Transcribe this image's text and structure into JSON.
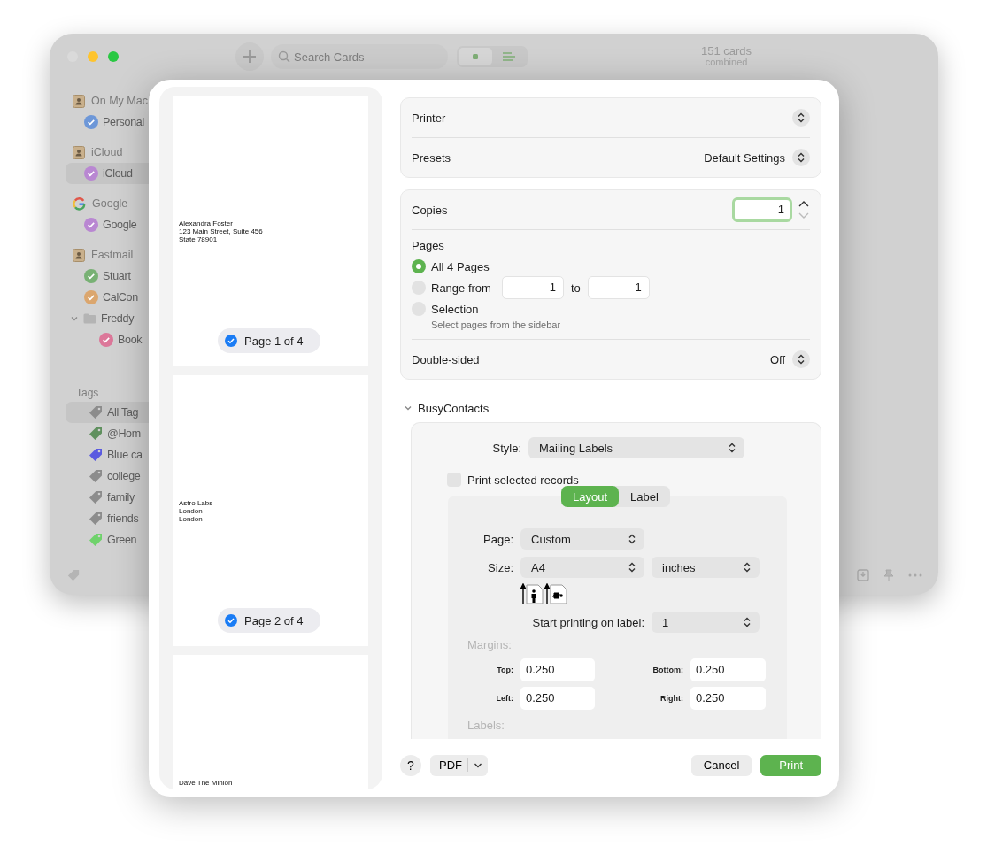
{
  "background_window": {
    "toolbar": {
      "search": {
        "placeholder": "Search Cards"
      },
      "card_count": "151 cards",
      "card_count_caption": "combined"
    },
    "sidebar": {
      "sources": [
        {
          "title": "On My Mac",
          "kind": "book",
          "items": [
            {
              "label": "Personal",
              "kind": "calendar",
              "color": "#6d97d8",
              "selected": false
            }
          ]
        },
        {
          "title": "iCloud",
          "kind": "book",
          "items": [
            {
              "label": "iCloud",
              "kind": "calendar",
              "color": "#b987d2",
              "selected": true
            }
          ]
        },
        {
          "title": "Google",
          "kind": "google",
          "items": [
            {
              "label": "Google",
              "kind": "calendar",
              "color": "#b987d2",
              "selected": false
            }
          ]
        },
        {
          "title": "Fastmail",
          "kind": "book",
          "items": [
            {
              "label": "Stuart",
              "kind": "calendar",
              "color": "#78b174",
              "selected": false
            },
            {
              "label": "CalCon",
              "kind": "calendar",
              "color": "#dba66e",
              "selected": false
            },
            {
              "label": "Freddy",
              "kind": "folder",
              "expanded": true,
              "selected": false,
              "children": [
                {
                  "label": "Book",
                  "kind": "calendar",
                  "color": "#dc7799",
                  "selected": false
                }
              ]
            }
          ]
        }
      ],
      "tags_heading": "Tags",
      "tags": [
        {
          "label": "All Tag",
          "color": "#8c8c8c",
          "selected": true
        },
        {
          "label": "@Hom",
          "color": "#5f905e",
          "selected": false
        },
        {
          "label": "Blue ca",
          "color": "#5a5ae0",
          "selected": false
        },
        {
          "label": "college",
          "color": "#8c8c8c",
          "selected": false
        },
        {
          "label": "family",
          "color": "#8c8c8c",
          "selected": false
        },
        {
          "label": "friends",
          "color": "#8c8c8c",
          "selected": false
        },
        {
          "label": "Green",
          "color": "#6fd26b",
          "selected": false
        }
      ]
    }
  },
  "print_dialog": {
    "preview_pages": [
      {
        "label": "Page 1 of 4",
        "checked": true,
        "address_lines": [
          "Alexandra Foster",
          "123 Main Street, Suite 456",
          "State 78901"
        ]
      },
      {
        "label": "Page 2 of 4",
        "checked": true,
        "address_lines": [
          "Astro Labs",
          "London",
          "London"
        ]
      },
      {
        "address_lines": [
          "Dave The Minion"
        ]
      }
    ],
    "printer": {
      "label": "Printer"
    },
    "presets": {
      "label": "Presets",
      "value": "Default Settings"
    },
    "copies": {
      "label": "Copies",
      "value": "1"
    },
    "pages": {
      "label": "Pages",
      "options": [
        {
          "kind": "plain",
          "label": "All 4 Pages",
          "selected": true
        },
        {
          "kind": "range",
          "label": "Range from",
          "selected": false,
          "from": "1",
          "to_label": "to",
          "to": "1"
        },
        {
          "kind": "hint",
          "label": "Selection",
          "selected": false,
          "hint": "Select pages from the sidebar"
        }
      ]
    },
    "double_sided": {
      "label": "Double-sided",
      "value": "Off"
    },
    "app_section": {
      "title": "BusyContacts",
      "expanded": true,
      "style": {
        "label": "Style:",
        "value": "Mailing Labels"
      },
      "print_selected": {
        "label": "Print selected records",
        "checked": false
      },
      "tabs": [
        {
          "label": "Layout",
          "selected": true
        },
        {
          "label": "Label",
          "selected": false
        }
      ],
      "page": {
        "label": "Page:",
        "value": "Custom"
      },
      "size": {
        "label": "Size:",
        "value": "A4",
        "unit": "inches"
      },
      "start_label": {
        "label": "Start printing on label:",
        "value": "1"
      },
      "margins_heading": "Margins:",
      "margins": [
        {
          "label": "Top:",
          "value": "0.250"
        },
        {
          "label": "Bottom:",
          "value": "0.250"
        },
        {
          "label": "Left:",
          "value": "0.250"
        },
        {
          "label": "Right:",
          "value": "0.250"
        }
      ],
      "labels_heading": "Labels:"
    },
    "footer": {
      "help": "?",
      "pdf": "PDF",
      "cancel": "Cancel",
      "print": "Print"
    }
  }
}
